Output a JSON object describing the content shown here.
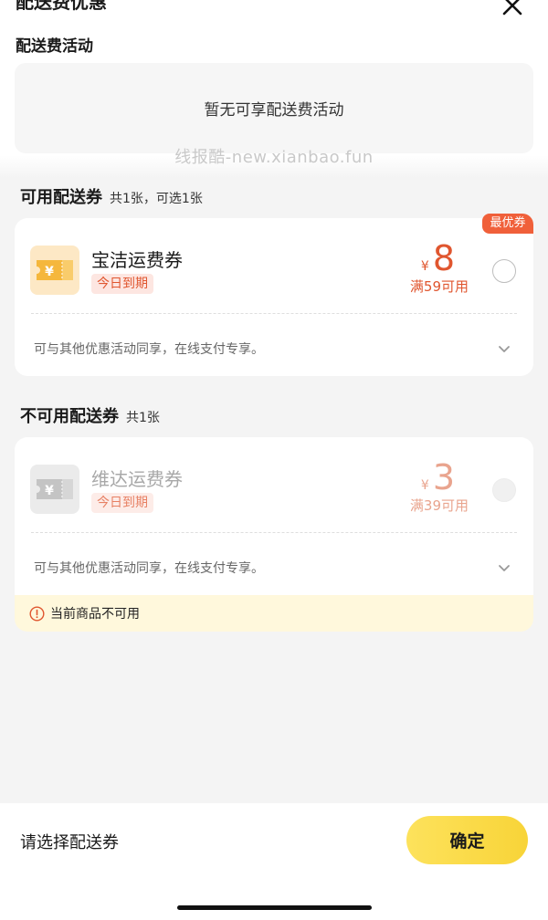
{
  "header": {
    "title": "配送费优惠"
  },
  "activity_section": {
    "label": "配送费活动",
    "empty_text": "暂无可享配送费活动"
  },
  "watermark": "线报酷-new.xianbao.fun",
  "available_section": {
    "title": "可用配送券",
    "summary": "共1张，可选1张"
  },
  "available_coupons": [
    {
      "badge": "最优券",
      "name": "宝洁运费券",
      "expire_tag": "今日到期",
      "currency": "¥",
      "amount": "8",
      "condition": "满59可用",
      "description": "可与其他优惠活动同享，在线支付专享。"
    }
  ],
  "unavailable_section": {
    "title": "不可用配送券",
    "summary": "共1张"
  },
  "unavailable_coupons": [
    {
      "name": "维达运费券",
      "expire_tag": "今日到期",
      "currency": "¥",
      "amount": "3",
      "condition": "满39可用",
      "description": "可与其他优惠活动同享，在线支付专享。",
      "reason": "当前商品不可用"
    }
  ],
  "footer": {
    "prompt": "请选择配送券",
    "confirm_label": "确定"
  },
  "colors": {
    "accent_red": "#e0562f",
    "disabled_red": "#e9a48e",
    "confirm_yellow": "#f9d844",
    "warning_bg": "#fff8dc"
  },
  "icons": {
    "close": "close-icon",
    "coupon_gold": "ticket-yen-icon",
    "coupon_grey": "ticket-yen-icon",
    "expand": "chevron-down-icon",
    "warning": "exclamation-circle-icon"
  }
}
